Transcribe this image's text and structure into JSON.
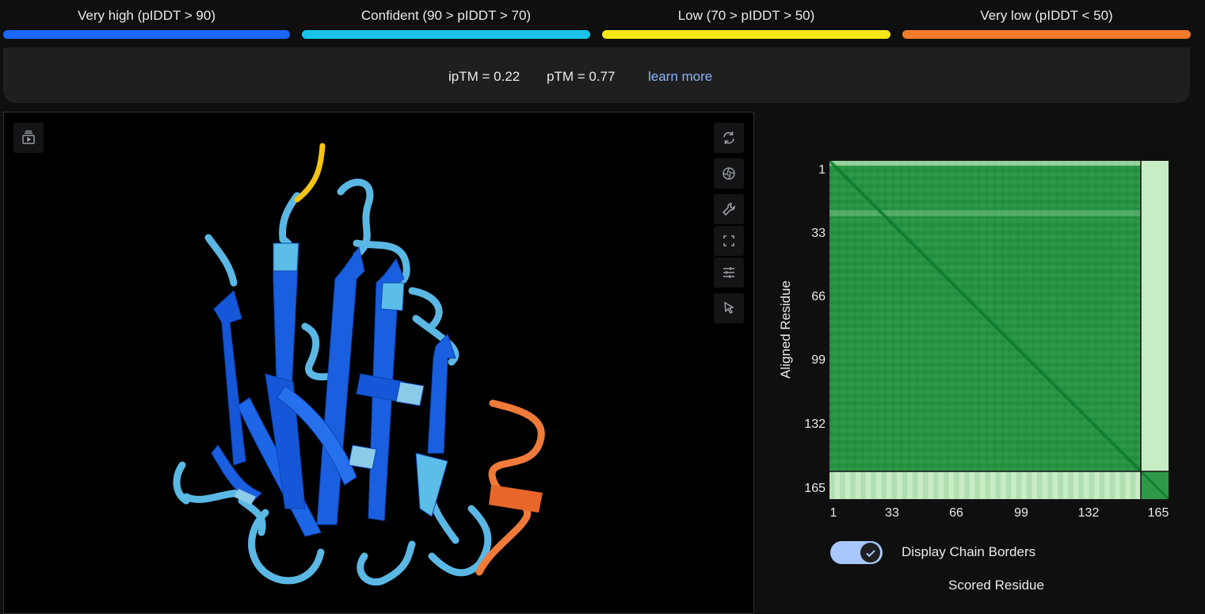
{
  "legend": [
    {
      "label": "Very high (pIDDT > 90)",
      "color": "#1a66ff"
    },
    {
      "label": "Confident (90 > pIDDT > 70)",
      "color": "#19c4e8"
    },
    {
      "label": "Low (70 > pIDDT > 50)",
      "color": "#f5e616"
    },
    {
      "label": "Very low (pIDDT < 50)",
      "color": "#f47a2c"
    }
  ],
  "scores": {
    "iptm": "ipTM = 0.22",
    "ptm": "pTM = 0.77",
    "learn_more": "learn more"
  },
  "viewer": {
    "tools": [
      "play-icon",
      "reset-rotation-icon",
      "camera-icon",
      "wrench-icon",
      "fullscreen-icon",
      "sliders-icon",
      "pointer-icon"
    ]
  },
  "pae": {
    "y_label": "Aligned Residue",
    "x_label": "Scored Residue",
    "y_ticks": [
      "1",
      "33",
      "66",
      "99",
      "132",
      "165"
    ],
    "x_ticks": [
      "1",
      "33",
      "66",
      "99",
      "132",
      "165"
    ],
    "toggle_label": "Display Chain Borders",
    "toggle_on": true,
    "chain_boundary_residue": 158,
    "total_residues": 172,
    "colors": {
      "dark": "#0a7a2c",
      "mid": "#2e9a48",
      "light": "#c8ecc4"
    }
  }
}
